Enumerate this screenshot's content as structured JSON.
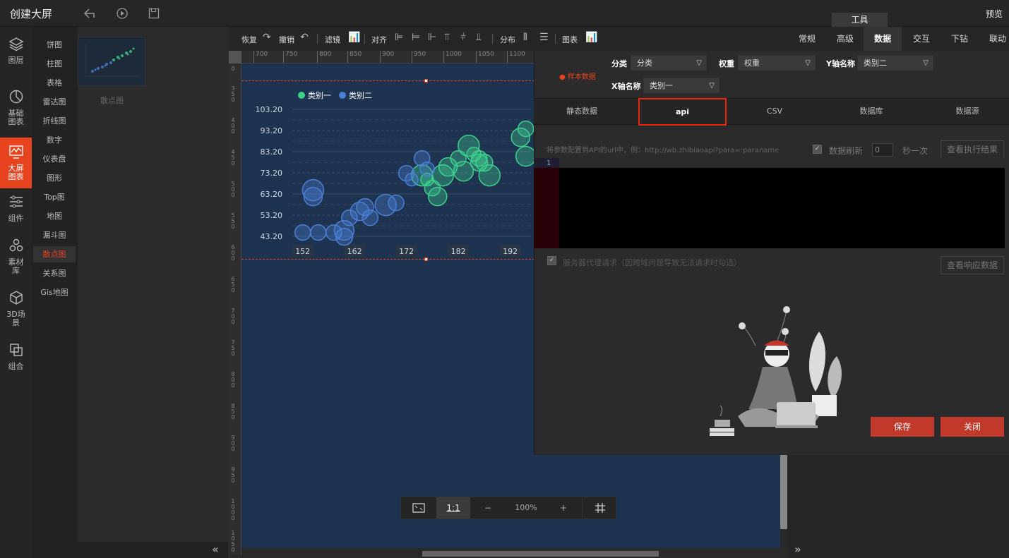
{
  "header": {
    "title": "创建大屏",
    "tools_tab": "工具",
    "preview": "预览",
    "icons": [
      "undo-arrow-icon",
      "play-icon",
      "save-icon"
    ]
  },
  "sidenav": [
    {
      "label": "图层",
      "icon": "layers-icon"
    },
    {
      "label": "基础图表",
      "icon": "pie-chart-icon"
    },
    {
      "label": "大屏图表",
      "icon": "screen-chart-icon",
      "active": true
    },
    {
      "label": "组件",
      "icon": "sliders-icon"
    },
    {
      "label": "素材库",
      "icon": "hexagons-icon"
    },
    {
      "label": "3D场景",
      "icon": "cube-icon"
    },
    {
      "label": "组合",
      "icon": "combine-icon"
    }
  ],
  "subnav": [
    "饼图",
    "柱图",
    "表格",
    "雷达图",
    "折线图",
    "数字",
    "仪表盘",
    "图形",
    "Top图",
    "地图",
    "漏斗图",
    "散点图",
    "关系图",
    "Gis地图"
  ],
  "subnav_active": "散点图",
  "thumbnail_label": "散点图",
  "toolbar": {
    "redo": "恢复",
    "undo": "撤销",
    "filter": "滤镜",
    "align": "对齐",
    "distribute": "分布",
    "chart": "图表"
  },
  "ruler": {
    "h": [
      "700",
      "750",
      "800",
      "850",
      "900",
      "950",
      "1000",
      "1050",
      "1100"
    ],
    "v": [
      "0",
      "3 5 0",
      "4 0 0",
      "4 5 0",
      "5 0 0",
      "5 5 0",
      "6 0 0",
      "6 5 0",
      "7 0 0",
      "7 5 0",
      "8 0 0",
      "8 5 0",
      "9 0 0",
      "9 5 0",
      "1 0 0 0",
      "1 0 5 0"
    ]
  },
  "chart_data": {
    "type": "scatter",
    "legend": [
      "类别一",
      "类别二"
    ],
    "legend_position": "top-left",
    "colors": {
      "类别一": "#3ecf8e",
      "类别二": "#4a7fd4"
    },
    "y_ticks": [
      "103.20",
      "93.20",
      "83.20",
      "73.20",
      "63.20",
      "53.20",
      "43.20"
    ],
    "x_ticks": [
      "152",
      "162",
      "172",
      "182",
      "192"
    ],
    "ylim": [
      43.2,
      103.2
    ],
    "xlim": [
      150,
      196
    ],
    "series": [
      {
        "name": "类别一",
        "points": [
          [
            175,
            72
          ],
          [
            176,
            70
          ],
          [
            177,
            66
          ],
          [
            178,
            62
          ],
          [
            179,
            72
          ],
          [
            180,
            76
          ],
          [
            182,
            80
          ],
          [
            183,
            74
          ],
          [
            184,
            86
          ],
          [
            185,
            82
          ],
          [
            186,
            80
          ],
          [
            187,
            78
          ],
          [
            188,
            72
          ],
          [
            194,
            90
          ],
          [
            195,
            94
          ],
          [
            195,
            81
          ],
          [
            186,
            78
          ]
        ]
      },
      {
        "name": "类别二",
        "points": [
          [
            152,
            45
          ],
          [
            155,
            45
          ],
          [
            158,
            45
          ],
          [
            160,
            46
          ],
          [
            160,
            43
          ],
          [
            161,
            52
          ],
          [
            163,
            55
          ],
          [
            164,
            57
          ],
          [
            165,
            52
          ],
          [
            168,
            58
          ],
          [
            170,
            59
          ],
          [
            172,
            73
          ],
          [
            173,
            70
          ],
          [
            175,
            80
          ],
          [
            176,
            75
          ],
          [
            154,
            62
          ],
          [
            154,
            65
          ]
        ]
      }
    ]
  },
  "zoombar": {
    "ratio": "1:1",
    "minus": "−",
    "percent": "100%",
    "plus": "+"
  },
  "prop_tabs": [
    "常规",
    "高级",
    "数据",
    "交互",
    "下钻",
    "联动"
  ],
  "prop_tab_active": "数据",
  "data_panel": {
    "sample_label": "样本数据",
    "fields": [
      {
        "label": "分类",
        "value": "分类"
      },
      {
        "label": "权重",
        "value": "权重"
      },
      {
        "label": "Y轴名称",
        "value": "类别二"
      },
      {
        "label": "X轴名称",
        "value": "类别一"
      }
    ],
    "tabs": [
      "静态数据",
      "api",
      "CSV",
      "数据库",
      "数据源"
    ],
    "active_tab": "api",
    "api_hint": "将参数配置到API的url中，例：http://wb.zhibiaoapi?para=:paraname",
    "refresh_label": "数据刷新",
    "refresh_value": "0",
    "seconds_label": "秒一次",
    "view_result": "查看执行结果",
    "line_number": "1",
    "proxy_label": "服务器代理请求（因跨域问题导致无法请求时勾选）",
    "view_response": "查看响应数据",
    "save": "保存",
    "close": "关闭"
  }
}
